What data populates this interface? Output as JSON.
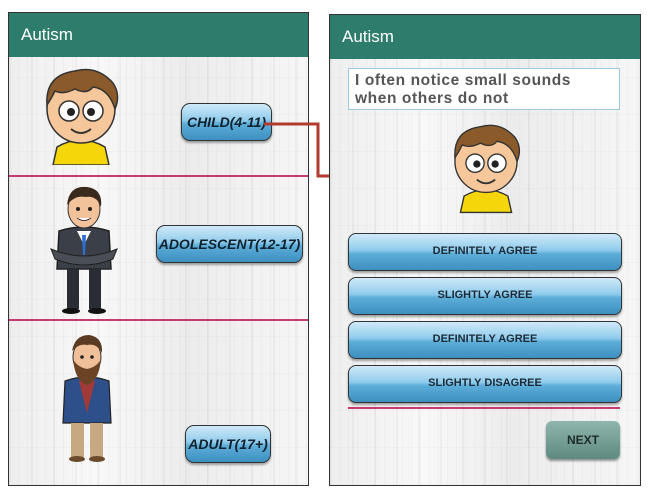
{
  "left_screen": {
    "app_title": "Autism",
    "options": [
      {
        "label": "CHILD(4-11)"
      },
      {
        "label": "ADOLESCENT(12-17)"
      },
      {
        "label": "ADULT(17+)"
      }
    ]
  },
  "right_screen": {
    "app_title": "Autism",
    "question": "I often notice small sounds when others do not",
    "answers": [
      {
        "label": "DEFINITELY AGREE"
      },
      {
        "label": "SLIGHTLY AGREE"
      },
      {
        "label": "DEFINITELY AGREE"
      },
      {
        "label": "SLIGHTLY DISAGREE"
      }
    ],
    "next_label": "NEXT"
  },
  "colors": {
    "app_bar": "#2e7d6c",
    "divider": "#c2185b",
    "arrow": "#b23a2e",
    "button": "#5cadd8"
  }
}
